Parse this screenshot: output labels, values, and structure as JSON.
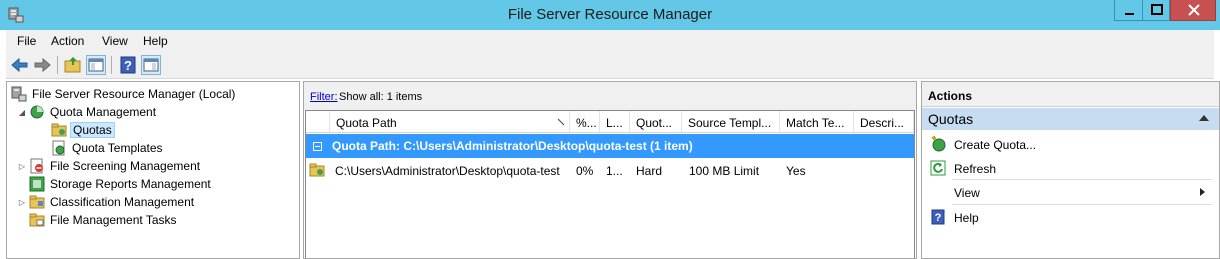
{
  "window": {
    "title": "File Server Resource Manager",
    "icons": [
      "app-icon",
      "minimize-icon",
      "maximize-icon",
      "close-icon"
    ]
  },
  "menu": [
    "File",
    "Action",
    "View",
    "Help"
  ],
  "toolbar": {
    "icons": [
      "back-arrow-icon",
      "forward-arrow-icon",
      "up-folder-icon",
      "show-hide-console-tree-icon",
      "help-icon",
      "show-hide-action-pane-icon"
    ]
  },
  "tree": {
    "root": "File Server Resource Manager (Local)",
    "items": [
      {
        "label": "Quota Management",
        "icon": "quota-management-icon"
      },
      {
        "label": "Quotas",
        "icon": "quotas-folder-icon"
      },
      {
        "label": "Quota Templates",
        "icon": "quota-templates-icon"
      },
      {
        "label": "File Screening Management",
        "icon": "file-screening-icon"
      },
      {
        "label": "Storage Reports Management",
        "icon": "storage-reports-icon"
      },
      {
        "label": "Classification Management",
        "icon": "classification-icon"
      },
      {
        "label": "File Management Tasks",
        "icon": "file-management-tasks-icon"
      }
    ]
  },
  "center": {
    "filter_link": "Filter:",
    "filter_text": "Show all: 1 items",
    "columns": [
      "Quota Path",
      "%...",
      "L...",
      "Quot...",
      "Source Templ...",
      "Match Te...",
      "Descri..."
    ],
    "group_label": "Quota Path: C:\\Users\\Administrator\\Desktop\\quota-test (1 item)",
    "rows": [
      {
        "path": "C:\\Users\\Administrator\\Desktop\\quota-test",
        "percent": "0%",
        "limit": "1...",
        "quota_type": "Hard",
        "source_template": "100 MB Limit",
        "match_template": "Yes",
        "description": ""
      }
    ]
  },
  "actions": {
    "header": "Actions",
    "section": "Quotas",
    "items": [
      {
        "label": "Create Quota...",
        "icon": "create-quota-icon"
      },
      {
        "label": "Refresh",
        "icon": "refresh-icon"
      },
      {
        "label": "View",
        "icon": ""
      },
      {
        "label": "Help",
        "icon": "help-icon"
      }
    ]
  },
  "colors": {
    "titlebar": "#63c8e8",
    "selection": "#3399ff",
    "close_button": "#c75050",
    "section_header": "#c6dcf0"
  }
}
